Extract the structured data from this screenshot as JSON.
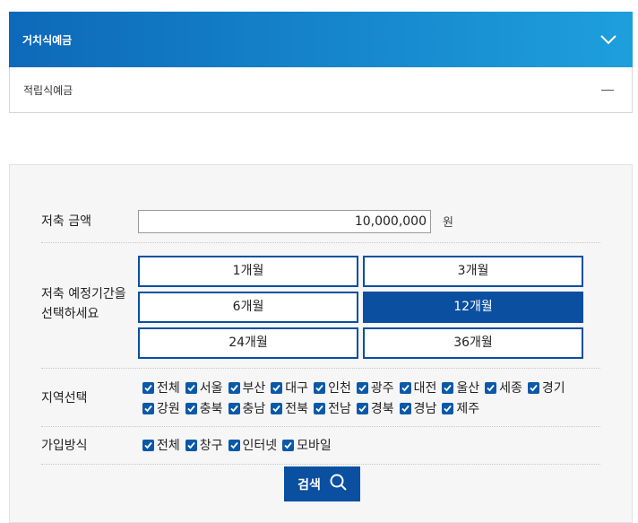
{
  "tabs": {
    "active_label": "거치식예금",
    "inactive_label": "적립식예금"
  },
  "form": {
    "amount_label": "저축 금액",
    "amount_value": "10,000,000",
    "amount_unit": "원",
    "period_label_line1": "저축 예정기간을",
    "period_label_line2": "선택하세요",
    "periods": [
      "1개월",
      "3개월",
      "6개월",
      "12개월",
      "24개월",
      "36개월"
    ],
    "selected_period": "12개월",
    "region_label": "지역선택",
    "regions": [
      "전체",
      "서울",
      "부산",
      "대구",
      "인천",
      "광주",
      "대전",
      "울산",
      "세종",
      "경기",
      "강원",
      "충북",
      "충남",
      "전북",
      "전남",
      "경북",
      "경남",
      "제주"
    ],
    "join_label": "가입방식",
    "join_methods": [
      "전체",
      "창구",
      "인터넷",
      "모바일"
    ],
    "search_label": "검색"
  },
  "colors": {
    "primary": "#0a4fa0",
    "gradient_start": "#0d69b9",
    "gradient_end": "#1e9fdd",
    "checkbox": "#0a59a8"
  },
  "icons": {
    "expand": "chevron-down-icon",
    "collapse": "minus-icon",
    "search": "search-icon",
    "check": "check-icon"
  }
}
